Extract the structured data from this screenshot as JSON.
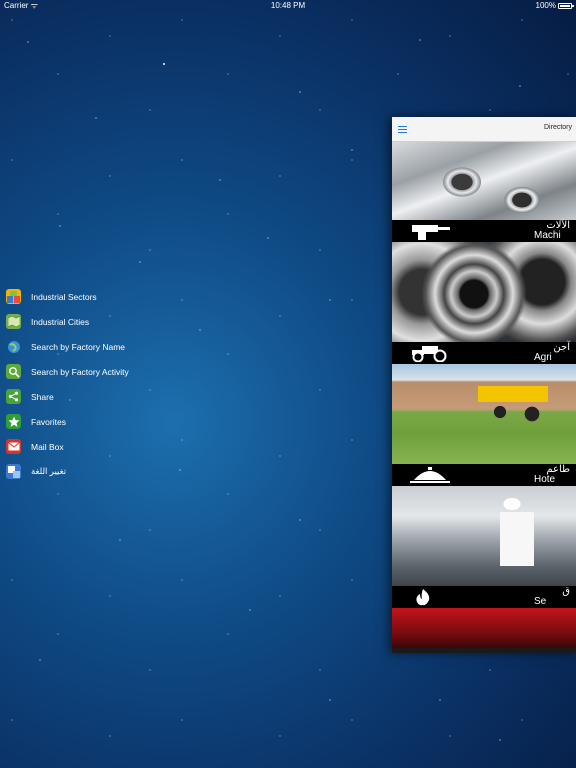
{
  "status_bar": {
    "carrier": "Carrier ᯤ",
    "time": "10:48 PM",
    "battery": "100%"
  },
  "side_menu": {
    "items": [
      {
        "label": "Industrial Sectors",
        "icon": "blocks-icon",
        "color": "#f5b400"
      },
      {
        "label": "Industrial Cities",
        "icon": "map-icon",
        "color": "#6fb04b"
      },
      {
        "label": "Search by Factory Name",
        "icon": "globe-icon",
        "color": "#3d8fd6"
      },
      {
        "label": "Search by Factory Activity",
        "icon": "search-icon",
        "color": "#5caa3a"
      },
      {
        "label": "Share",
        "icon": "share-icon",
        "color": "#49a33a"
      },
      {
        "label": "Favorites",
        "icon": "star-icon",
        "color": "#2e9e3a"
      },
      {
        "label": "Mail Box",
        "icon": "mail-icon",
        "color": "#d9342b"
      },
      {
        "label": "تغيير اللغة",
        "icon": "language-icon",
        "color": "#3a7ad1"
      }
    ]
  },
  "panel": {
    "title": "Directory",
    "categories": [
      {
        "arabic": "الآلات",
        "english": "Machi",
        "icon": "drill-icon"
      },
      {
        "arabic": "آجن",
        "english": "Agri",
        "icon": "tractor-icon"
      },
      {
        "arabic": "طاعم",
        "english": "Hote",
        "icon": "cloche-icon"
      },
      {
        "arabic": "ق",
        "english": "Se",
        "icon": "flame-icon"
      }
    ]
  }
}
